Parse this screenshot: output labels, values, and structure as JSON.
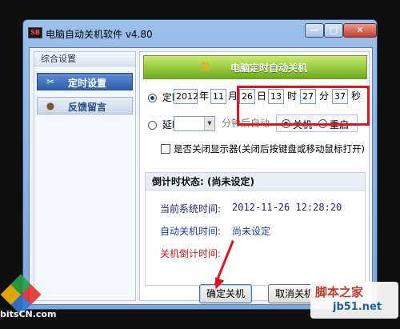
{
  "window": {
    "title": "电脑自动关机软件 v4.80",
    "icon_text": "SB"
  },
  "caption_buttons": {
    "minimize": "—",
    "maximize": "□",
    "close": "✕"
  },
  "sidebar": {
    "header": "综合设置",
    "items": [
      {
        "label": "定时设置",
        "icon": "tools-icon",
        "active": true
      },
      {
        "label": "反馈留言",
        "icon": "user-icon",
        "active": false
      }
    ]
  },
  "banner": {
    "title": "电脑定时自动关机",
    "icon": "up-down-arrows-icon"
  },
  "timed": {
    "label": "定时",
    "selected": true,
    "year": "2012",
    "year_unit": "年",
    "month": "11",
    "month_unit": "月",
    "day": "26",
    "day_unit": "日",
    "hour": "13",
    "hour_unit": "时",
    "minute": "27",
    "minute_unit": "分",
    "second": "37",
    "second_unit": "秒"
  },
  "delay": {
    "label": "延时",
    "selected": false,
    "minutes_value": "",
    "suffix": "分钟后自动",
    "action_shutdown": "关机",
    "action_restart": "重启",
    "action_selected": "shutdown"
  },
  "monitor_option": {
    "label": "是否关闭显示器(关闭后按键盘或移动鼠标打开)",
    "checked": false
  },
  "status": {
    "header": "倒计时状态: (尚未设定)",
    "current_time_label": "当前系统时间:",
    "current_time_value": "2012-11-26 12:28:20",
    "auto_shutdown_label": "自动关机时间:",
    "auto_shutdown_value": "尚未设定",
    "countdown_label": "关机倒计时间:",
    "countdown_value": ""
  },
  "buttons": {
    "confirm": "确定关机",
    "cancel": "取消关机"
  },
  "colors": {
    "accent": "#2f5fae",
    "banner": "#6dac1c",
    "highlight": "#e0141a",
    "blue_text": "#1b3a8a",
    "red_text": "#e0141a"
  },
  "watermarks": {
    "left": "bitsCN.com",
    "right_top": "脚本之家",
    "right_bottom": "jb51.net"
  }
}
